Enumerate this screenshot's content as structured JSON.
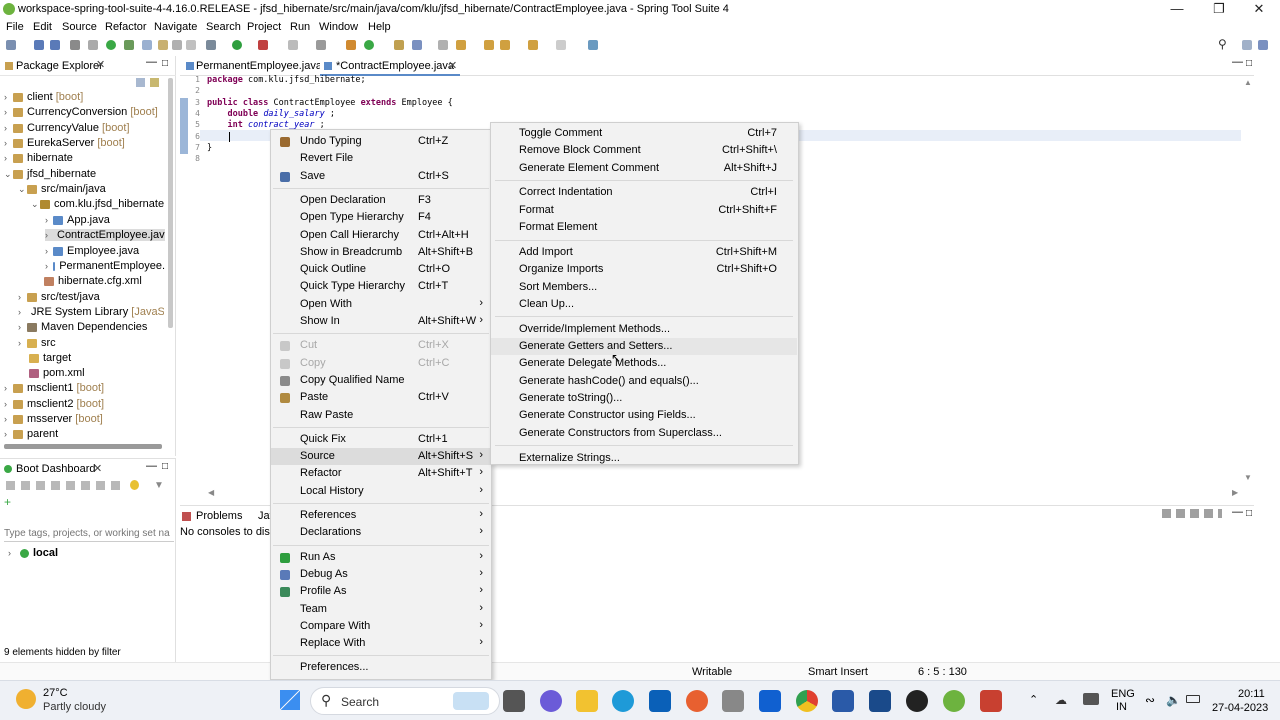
{
  "window": {
    "title": "workspace-spring-tool-suite-4-4.16.0.RELEASE - jfsd_hibernate/src/main/java/com/klu/jfsd_hibernate/ContractEmployee.java - Spring Tool Suite 4"
  },
  "menubar": [
    "File",
    "Edit",
    "Source",
    "Refactor",
    "Navigate",
    "Search",
    "Project",
    "Run",
    "Window",
    "Help"
  ],
  "package_explorer": {
    "title": "Package Explorer",
    "items": [
      {
        "label": "client",
        "tag": "[boot]"
      },
      {
        "label": "CurrencyConversion",
        "tag": "[boot]"
      },
      {
        "label": "CurrencyValue",
        "tag": "[boot]"
      },
      {
        "label": "EurekaServer",
        "tag": "[boot]"
      },
      {
        "label": "hibernate",
        "tag": ""
      },
      {
        "label": "jfsd_hibernate",
        "tag": ""
      },
      {
        "label": "src/main/java",
        "tag": ""
      },
      {
        "label": "com.klu.jfsd_hibernate",
        "tag": ""
      },
      {
        "label": "App.java",
        "tag": ""
      },
      {
        "label": "ContractEmployee.java",
        "tag": ""
      },
      {
        "label": "Employee.java",
        "tag": ""
      },
      {
        "label": "PermanentEmployee.",
        "tag": ""
      },
      {
        "label": "hibernate.cfg.xml",
        "tag": ""
      },
      {
        "label": "src/test/java",
        "tag": ""
      },
      {
        "label": "JRE System Library",
        "tag": "[JavaSE-"
      },
      {
        "label": "Maven Dependencies",
        "tag": ""
      },
      {
        "label": "src",
        "tag": ""
      },
      {
        "label": "target",
        "tag": ""
      },
      {
        "label": "pom.xml",
        "tag": ""
      },
      {
        "label": "msclient1",
        "tag": "[boot]"
      },
      {
        "label": "msclient2",
        "tag": "[boot]"
      },
      {
        "label": "msserver",
        "tag": "[boot]"
      },
      {
        "label": "parent",
        "tag": ""
      }
    ]
  },
  "boot_dashboard": {
    "title": "Boot Dashboard",
    "filter_placeholder": "Type tags, projects, or working set na",
    "local": "local",
    "hidden": "9 elements hidden by filter"
  },
  "editor": {
    "tabs": [
      {
        "label": "PermanentEmployee.java"
      },
      {
        "label": "*ContractEmployee.java"
      }
    ],
    "lines": [
      {
        "n": "1",
        "parts": [
          [
            "kw",
            "package"
          ],
          [
            "",
            "com.klu.jfsd_hibernate;"
          ]
        ]
      },
      {
        "n": "2",
        "parts": []
      },
      {
        "n": "3",
        "parts": [
          [
            "kw",
            "public class"
          ],
          [
            "",
            "ContractEmployee"
          ],
          [
            "kw",
            "extends"
          ],
          [
            "",
            "Employee {"
          ]
        ]
      },
      {
        "n": "4",
        "parts": [
          [
            "kw",
            "    double"
          ],
          [
            "fld",
            "daily_salary"
          ],
          [
            "",
            ";"
          ]
        ]
      },
      {
        "n": "5",
        "parts": [
          [
            "kw",
            "    int"
          ],
          [
            "fld",
            "contract_year"
          ],
          [
            "",
            ";"
          ]
        ]
      },
      {
        "n": "6",
        "parts": []
      },
      {
        "n": "7",
        "parts": [
          [
            "",
            "}"
          ]
        ]
      },
      {
        "n": "8",
        "parts": []
      }
    ]
  },
  "bottom_panel": {
    "tab_problems": "Problems",
    "tab_java": "Jav",
    "console_text": "No consoles to displ"
  },
  "status": {
    "writable": "Writable",
    "insert": "Smart Insert",
    "position": "6 : 5 : 130"
  },
  "context_menu": [
    {
      "label": "Undo Typing",
      "acc": "Ctrl+Z",
      "icon": "undo-icon",
      "color": "#9a6a30"
    },
    {
      "label": "Revert File",
      "acc": ""
    },
    {
      "label": "Save",
      "acc": "Ctrl+S",
      "icon": "save-icon",
      "color": "#4a6ea8"
    },
    {
      "sep": true
    },
    {
      "label": "Open Declaration",
      "acc": "F3"
    },
    {
      "label": "Open Type Hierarchy",
      "acc": "F4"
    },
    {
      "label": "Open Call Hierarchy",
      "acc": "Ctrl+Alt+H"
    },
    {
      "label": "Show in Breadcrumb",
      "acc": "Alt+Shift+B"
    },
    {
      "label": "Quick Outline",
      "acc": "Ctrl+O"
    },
    {
      "label": "Quick Type Hierarchy",
      "acc": "Ctrl+T"
    },
    {
      "label": "Open With",
      "acc": "",
      "sub": true
    },
    {
      "label": "Show In",
      "acc": "Alt+Shift+W",
      "sub": true
    },
    {
      "sep": true
    },
    {
      "label": "Cut",
      "acc": "Ctrl+X",
      "disabled": true,
      "icon": "cut-icon",
      "color": "#c8c8c8"
    },
    {
      "label": "Copy",
      "acc": "Ctrl+C",
      "disabled": true,
      "icon": "copy-icon",
      "color": "#c8c8c8"
    },
    {
      "label": "Copy Qualified Name",
      "acc": "",
      "icon": "copy-qualified-icon",
      "color": "#8a8a8a"
    },
    {
      "label": "Paste",
      "acc": "Ctrl+V",
      "icon": "paste-icon",
      "color": "#b08a40"
    },
    {
      "label": "Raw Paste",
      "acc": ""
    },
    {
      "sep": true
    },
    {
      "label": "Quick Fix",
      "acc": "Ctrl+1"
    },
    {
      "label": "Source",
      "acc": "Alt+Shift+S",
      "sub": true,
      "active": true
    },
    {
      "label": "Refactor",
      "acc": "Alt+Shift+T",
      "sub": true
    },
    {
      "label": "Local History",
      "acc": "",
      "sub": true
    },
    {
      "sep": true
    },
    {
      "label": "References",
      "acc": "",
      "sub": true
    },
    {
      "label": "Declarations",
      "acc": "",
      "sub": true
    },
    {
      "sep": true
    },
    {
      "label": "Run As",
      "acc": "",
      "sub": true,
      "icon": "run-icon",
      "color": "#2e9e3e"
    },
    {
      "label": "Debug As",
      "acc": "",
      "sub": true,
      "icon": "debug-icon",
      "color": "#5a7ab8"
    },
    {
      "label": "Profile As",
      "acc": "",
      "sub": true,
      "icon": "profile-icon",
      "color": "#3b8a5a"
    },
    {
      "label": "Team",
      "acc": "",
      "sub": true
    },
    {
      "label": "Compare With",
      "acc": "",
      "sub": true
    },
    {
      "label": "Replace With",
      "acc": "",
      "sub": true
    },
    {
      "sep": true
    },
    {
      "label": "Preferences...",
      "acc": ""
    }
  ],
  "source_menu": [
    {
      "label": "Toggle Comment",
      "acc": "Ctrl+7"
    },
    {
      "label": "Remove Block Comment",
      "acc": "Ctrl+Shift+\\"
    },
    {
      "label": "Generate Element Comment",
      "acc": "Alt+Shift+J"
    },
    {
      "sep": true
    },
    {
      "label": "Correct Indentation",
      "acc": "Ctrl+I"
    },
    {
      "label": "Format",
      "acc": "Ctrl+Shift+F"
    },
    {
      "label": "Format Element",
      "acc": ""
    },
    {
      "sep": true
    },
    {
      "label": "Add Import",
      "acc": "Ctrl+Shift+M"
    },
    {
      "label": "Organize Imports",
      "acc": "Ctrl+Shift+O"
    },
    {
      "label": "Sort Members...",
      "acc": ""
    },
    {
      "label": "Clean Up...",
      "acc": ""
    },
    {
      "sep": true
    },
    {
      "label": "Override/Implement Methods...",
      "acc": ""
    },
    {
      "label": "Generate Getters and Setters...",
      "acc": "",
      "hover": true
    },
    {
      "label": "Generate Delegate Methods...",
      "acc": ""
    },
    {
      "label": "Generate hashCode() and equals()...",
      "acc": ""
    },
    {
      "label": "Generate toString()...",
      "acc": ""
    },
    {
      "label": "Generate Constructor using Fields...",
      "acc": ""
    },
    {
      "label": "Generate Constructors from Superclass...",
      "acc": ""
    },
    {
      "sep": true
    },
    {
      "label": "Externalize Strings...",
      "acc": ""
    }
  ],
  "taskbar": {
    "weather_temp": "27°C",
    "weather_desc": "Partly cloudy",
    "search": "Search",
    "lang1": "ENG",
    "lang2": "IN",
    "time": "20:11",
    "date": "27-04-2023"
  }
}
